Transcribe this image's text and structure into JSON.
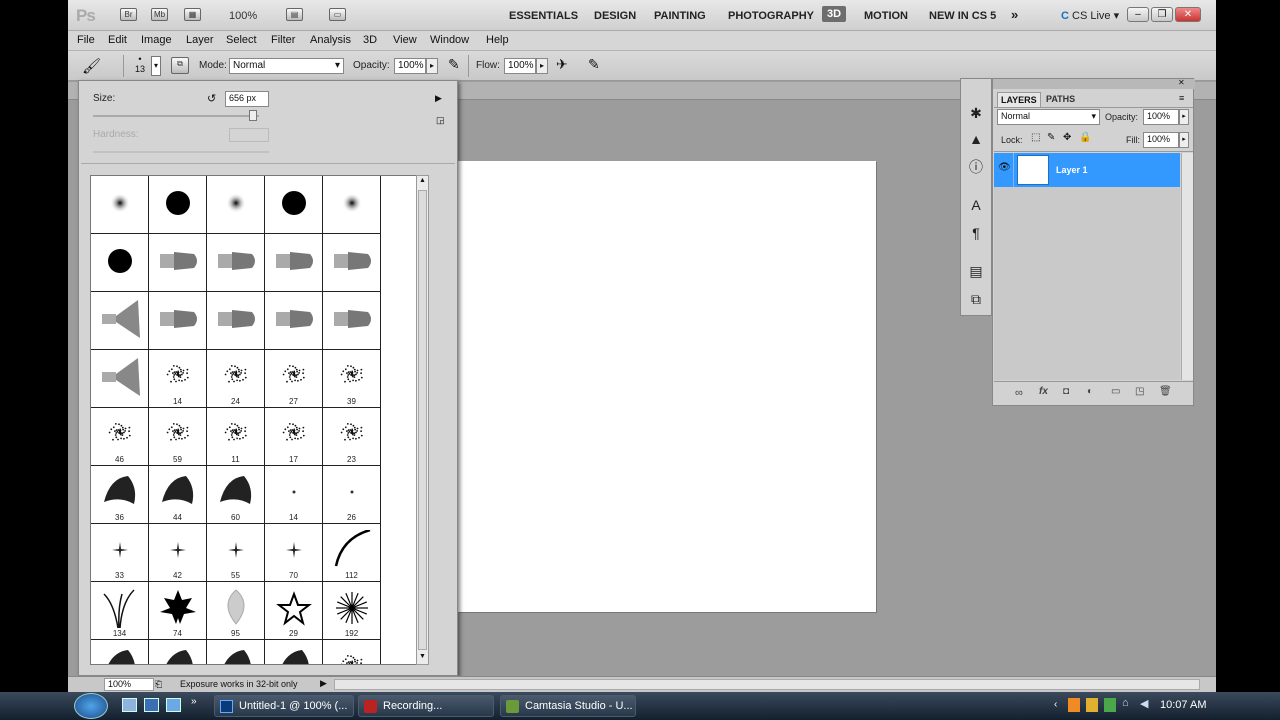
{
  "app_bar": {
    "logo": "Ps",
    "zoom": "100%",
    "workspaces": [
      "ESSENTIALS",
      "DESIGN",
      "PAINTING",
      "PHOTOGRAPHY",
      "3D",
      "MOTION",
      "NEW IN CS 5"
    ],
    "active_workspace": "3D",
    "cs_live": "CS Live"
  },
  "menu": [
    "File",
    "Edit",
    "Image",
    "Layer",
    "Select",
    "Filter",
    "Analysis",
    "3D",
    "View",
    "Window",
    "Help"
  ],
  "options": {
    "brush_size": "13",
    "mode_label": "Mode:",
    "mode_value": "Normal",
    "opacity_label": "Opacity:",
    "opacity_value": "100%",
    "flow_label": "Flow:",
    "flow_value": "100%"
  },
  "brush_panel": {
    "size_label": "Size:",
    "size_value": "656 px",
    "hardness_label": "Hardness:",
    "cells": [
      {
        "kind": "soft",
        "label": ""
      },
      {
        "kind": "hard",
        "label": ""
      },
      {
        "kind": "soft",
        "label": ""
      },
      {
        "kind": "hard",
        "label": ""
      },
      {
        "kind": "soft",
        "label": ""
      },
      {
        "kind": "hard",
        "label": ""
      },
      {
        "kind": "brush",
        "label": ""
      },
      {
        "kind": "brush",
        "label": ""
      },
      {
        "kind": "brush",
        "label": ""
      },
      {
        "kind": "brush",
        "label": ""
      },
      {
        "kind": "fan",
        "label": ""
      },
      {
        "kind": "brush",
        "label": ""
      },
      {
        "kind": "brush",
        "label": ""
      },
      {
        "kind": "brush",
        "label": ""
      },
      {
        "kind": "brush",
        "label": ""
      },
      {
        "kind": "fan",
        "label": ""
      },
      {
        "kind": "spray",
        "label": "14"
      },
      {
        "kind": "spray",
        "label": "24"
      },
      {
        "kind": "spray",
        "label": "27"
      },
      {
        "kind": "spray",
        "label": "39"
      },
      {
        "kind": "spray",
        "label": "46"
      },
      {
        "kind": "spray",
        "label": "59"
      },
      {
        "kind": "spray",
        "label": "11"
      },
      {
        "kind": "spray",
        "label": "17"
      },
      {
        "kind": "spray",
        "label": "23"
      },
      {
        "kind": "leaf",
        "label": "36"
      },
      {
        "kind": "leaf",
        "label": "44"
      },
      {
        "kind": "leaf",
        "label": "60"
      },
      {
        "kind": "dot",
        "label": "14"
      },
      {
        "kind": "dot",
        "label": "26"
      },
      {
        "kind": "star",
        "label": "33"
      },
      {
        "kind": "star",
        "label": "42"
      },
      {
        "kind": "star",
        "label": "55"
      },
      {
        "kind": "star",
        "label": "70"
      },
      {
        "kind": "curve",
        "label": "112"
      },
      {
        "kind": "grass",
        "label": "134"
      },
      {
        "kind": "maple",
        "label": "74"
      },
      {
        "kind": "ghostleaf",
        "label": "95"
      },
      {
        "kind": "outline_star",
        "label": "29"
      },
      {
        "kind": "burst",
        "label": "192"
      },
      {
        "kind": "leaf",
        "label": ""
      },
      {
        "kind": "leaf",
        "label": ""
      },
      {
        "kind": "leaf",
        "label": ""
      },
      {
        "kind": "leaf",
        "label": ""
      },
      {
        "kind": "spray",
        "label": ""
      }
    ]
  },
  "layers_panel": {
    "tabs": [
      "LAYERS",
      "PATHS"
    ],
    "blend_mode": "Normal",
    "opacity_label": "Opacity:",
    "opacity_value": "100%",
    "lock_label": "Lock:",
    "fill_label": "Fill:",
    "fill_value": "100%",
    "layer_name": "Layer 1"
  },
  "status": {
    "zoom": "100%",
    "message": "Exposure works in 32-bit only"
  },
  "taskbar": {
    "tasks": [
      "Untitled-1 @ 100% (...",
      "Recording...",
      "Camtasia Studio - U..."
    ],
    "time": "10:07 AM"
  },
  "colors": {
    "selection": "#3399ff",
    "workspace_bg": "#9c9c9c",
    "taskbar": "#1d2b3a"
  }
}
